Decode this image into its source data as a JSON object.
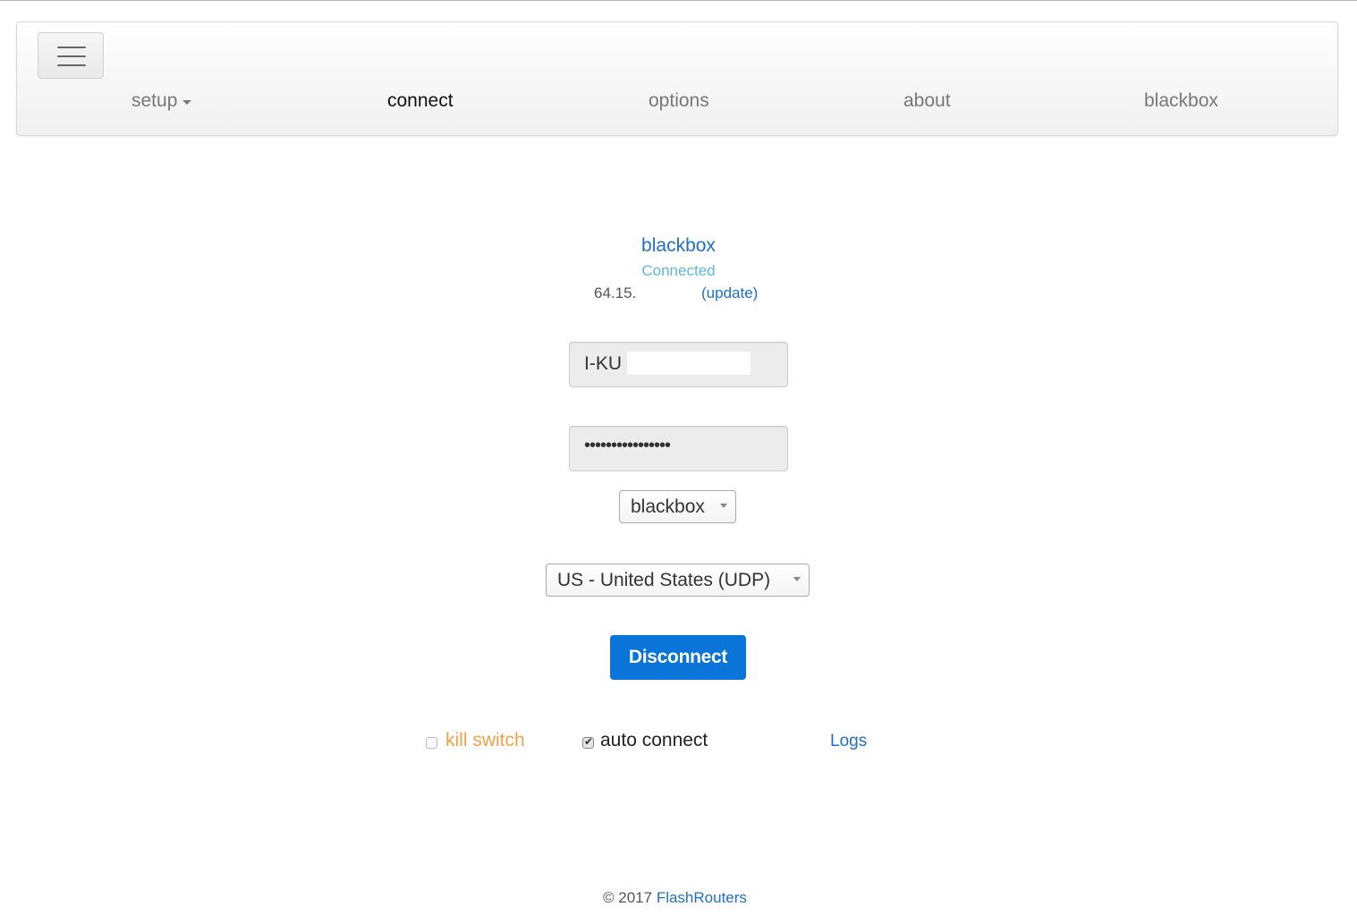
{
  "nav": {
    "menu_icon": "hamburger-menu-icon",
    "items": [
      {
        "label": "setup",
        "has_dropdown": true
      },
      {
        "label": "connect",
        "active": true
      },
      {
        "label": "options"
      },
      {
        "label": "about"
      },
      {
        "label": "blackbox"
      }
    ]
  },
  "status": {
    "device_name": "blackbox",
    "state": "Connected",
    "ip": "64.15.",
    "update_link": "(update)"
  },
  "form": {
    "username_value": "I-KU",
    "password_value": "••••••••••••••••",
    "server_select": "blackbox",
    "region_select": "US - United States (UDP)",
    "disconnect_label": "Disconnect"
  },
  "options": {
    "kill_switch": {
      "label": "kill switch",
      "checked": false
    },
    "auto_connect": {
      "label": "auto connect",
      "checked": true
    },
    "logs_link": "Logs"
  },
  "footer": {
    "copyright": "© 2017",
    "brand": "FlashRouters"
  },
  "colors": {
    "accent": "#1f6fc5",
    "button": "#0b74d8",
    "connected": "#5bb8e0",
    "kill_switch": "#f0a348"
  }
}
